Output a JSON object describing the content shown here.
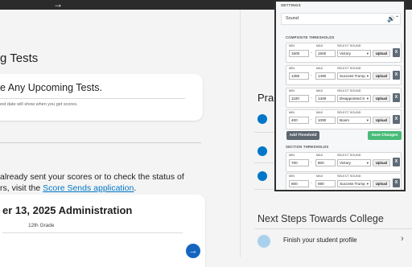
{
  "header": {
    "arrow": "→"
  },
  "main": {
    "title": "g Tests",
    "upcoming": {
      "heading": "e Any Upcoming Tests.",
      "note": "est date will show when you get scores."
    },
    "paragraph": {
      "line1": "already sent your scores or to check the status of",
      "line2_prefix": "rs, visit the ",
      "link": "Score Sends application",
      "line2_suffix": "."
    },
    "admin": {
      "title": "er 13, 2025 Administration",
      "grade": "12th Grade",
      "arrow": "→"
    }
  },
  "right": {
    "practice_title": "Prac",
    "next_steps": {
      "title": "Next Steps Towards College",
      "item": "Finish your student profile",
      "chevron": "›"
    }
  },
  "settings": {
    "title": "SETTINGS",
    "sound_label": "Sound",
    "speaker_glyph": "🔊",
    "chevron": "⌃",
    "composite_title": "COMPOSITE THRESHOLDS",
    "section_title": "SECTION THRESHOLDS",
    "labels": {
      "min": "MIN",
      "max": "MAX",
      "select": "SELECT SOUND",
      "upload": "Upload",
      "x": "X",
      "dash": "-",
      "caret": "▾"
    },
    "composite_rows": [
      {
        "min": "1500",
        "max": "1600",
        "sound": "Victory"
      },
      {
        "min": "1350",
        "max": "1490",
        "sound": "Success Trump"
      },
      {
        "min": "1100",
        "max": "1349",
        "sound": "Disappointed S"
      },
      {
        "min": "400",
        "max": "1090",
        "sound": "Boom"
      }
    ],
    "section_rows": [
      {
        "min": "700",
        "max": "800",
        "sound": "Victory"
      },
      {
        "min": "600",
        "max": "690",
        "sound": "Success Trump"
      }
    ],
    "add_threshold": "Add Threshold",
    "save_changes": "Save Changes"
  }
}
